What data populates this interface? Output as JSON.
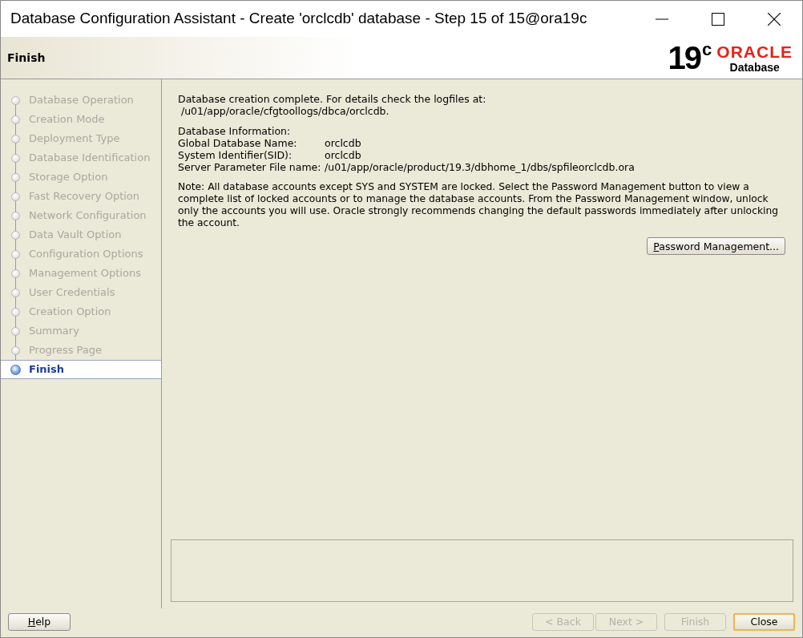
{
  "window": {
    "title": "Database Configuration Assistant - Create 'orclcdb' database - Step 15 of 15@ora19c"
  },
  "header": {
    "title": "Finish",
    "logo": {
      "version": "19",
      "superscript": "c",
      "brand": "ORACLE",
      "product": "Database"
    }
  },
  "steps": [
    {
      "label": "Database Operation",
      "selected": false
    },
    {
      "label": "Creation Mode",
      "selected": false
    },
    {
      "label": "Deployment Type",
      "selected": false
    },
    {
      "label": "Database Identification",
      "selected": false
    },
    {
      "label": "Storage Option",
      "selected": false
    },
    {
      "label": "Fast Recovery Option",
      "selected": false
    },
    {
      "label": "Network Configuration",
      "selected": false
    },
    {
      "label": "Data Vault Option",
      "selected": false
    },
    {
      "label": "Configuration Options",
      "selected": false
    },
    {
      "label": "Management Options",
      "selected": false
    },
    {
      "label": "User Credentials",
      "selected": false
    },
    {
      "label": "Creation Option",
      "selected": false
    },
    {
      "label": "Summary",
      "selected": false
    },
    {
      "label": "Progress Page",
      "selected": false
    },
    {
      "label": "Finish",
      "selected": true
    }
  ],
  "content": {
    "completion": "Database creation complete. For details check the logfiles at:",
    "log_path": " /u01/app/oracle/cfgtoollogs/dbca/orclcdb.",
    "info_heading": "Database Information:",
    "info": [
      {
        "label": "Global Database Name:",
        "value": "orclcdb"
      },
      {
        "label": "System Identifier(SID):",
        "value": "orclcdb"
      },
      {
        "label": "Server Parameter File name:",
        "value": "/u01/app/oracle/product/19.3/dbhome_1/dbs/spfileorclcdb.ora"
      }
    ],
    "note": "Note: All database accounts except SYS and SYSTEM are locked. Select the Password Management button to view a complete list of locked accounts or to manage the database accounts. From the Password Management window, unlock only the accounts you will use. Oracle strongly recommends changing the default passwords immediately after unlocking the account.",
    "password_button": "Password Management..."
  },
  "footer": {
    "help": "Help",
    "buttons": [
      {
        "label": "< Back",
        "disabled": true,
        "default": false
      },
      {
        "label": "Next >",
        "disabled": true,
        "default": false
      },
      {
        "label": "Finish",
        "disabled": true,
        "default": false
      },
      {
        "label": "Close",
        "disabled": false,
        "default": true
      }
    ]
  }
}
